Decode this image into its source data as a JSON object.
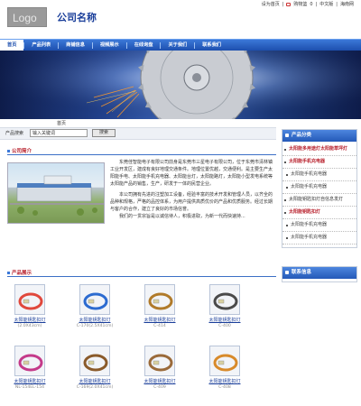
{
  "toplinks": {
    "home": "设为首页",
    "cart": "购物篮",
    "cart_count": "0",
    "lang_cn": "中文版",
    "lang_en": "海南网"
  },
  "logo": "Logo",
  "company_name": "公司名称",
  "nav": [
    "首页",
    "产品列表",
    "商铺信息",
    "视频展示",
    "在线询盘",
    "关于我们",
    "联系我们"
  ],
  "breadcrumb": "首页",
  "search": {
    "label": "产品搜索",
    "value": "输入关键词",
    "button": "搜索"
  },
  "intro": {
    "title": "公司简介",
    "paragraphs": [
      "东莞佳智能电子有限公司前身是东莞市三星电子有限公司，位于东莞市清林镇工业开发区，建成有良好地理交通条件。地理位置优越，交通便利。是主要生产太阳能手电、太阳能手机充电器、太阳能台灯，太阳能路灯，太阳能小型发电系统等太阳能产品的销售，生产，研发于一体的民营企业。",
      "本公司拥有先进的注塑加工设备，经验丰富的技术开发和管理人员，以齐全的品种和规格，严格的品控体系，为用户提供高质优价的产品和优质服务。经过长期与客户的合作，建立了良好的市场信誉。",
      "我们的一贯宗旨是以诚信待人，积极进取，为新一代而快速持..."
    ]
  },
  "products": {
    "title": "产品展示",
    "items": [
      {
        "name": "太阳能钥匙扣灯",
        "code": "(2.0X43cm)",
        "color": "#e0483c"
      },
      {
        "name": "太阳能钥匙扣灯",
        "code": "C-170(2.5X41cm)",
        "color": "#2c6bd0"
      },
      {
        "name": "太阳能钥匙扣灯",
        "code": "C-414",
        "color": "#b07a2a"
      },
      {
        "name": "太阳能钥匙扣灯",
        "code": "C-400",
        "color": "#4a4a4a"
      },
      {
        "name": "太阳能钥匙扣灯",
        "code": "NL-154EL-154",
        "color": "#c43a8a"
      },
      {
        "name": "太阳能钥匙扣灯",
        "code": "C-169(2.0X41cm)",
        "color": "#8a5a2a"
      },
      {
        "name": "太阳能钥匙扣灯",
        "code": "C-409",
        "color": "#9a6a3a"
      },
      {
        "name": "太阳能钥匙扣灯",
        "code": "C-408",
        "color": "#d88a2a"
      }
    ]
  },
  "sidebar": {
    "categories_title": "产品分类",
    "categories": [
      {
        "label": "太阳能多用途灯太阳能草坪灯",
        "kind": "bold"
      },
      {
        "label": "太阳能手机充电器",
        "kind": "bold"
      },
      {
        "label": "太阳能手机充电器",
        "kind": "sub"
      },
      {
        "label": "太阳能手机充电器",
        "kind": "sub"
      },
      {
        "label": "太阳能钥匙扣灯自信息发灯",
        "kind": "normal"
      },
      {
        "label": "太阳能钥匙扣灯",
        "kind": "bold"
      },
      {
        "label": "太阳能手机充电器",
        "kind": "sub"
      },
      {
        "label": "太阳能手机充电器",
        "kind": "sub"
      }
    ],
    "contact_title": "联系信息"
  },
  "colors": {
    "nav": "#2459b8",
    "accent_red": "#b8202c",
    "link_blue": "#1a3e9a"
  }
}
